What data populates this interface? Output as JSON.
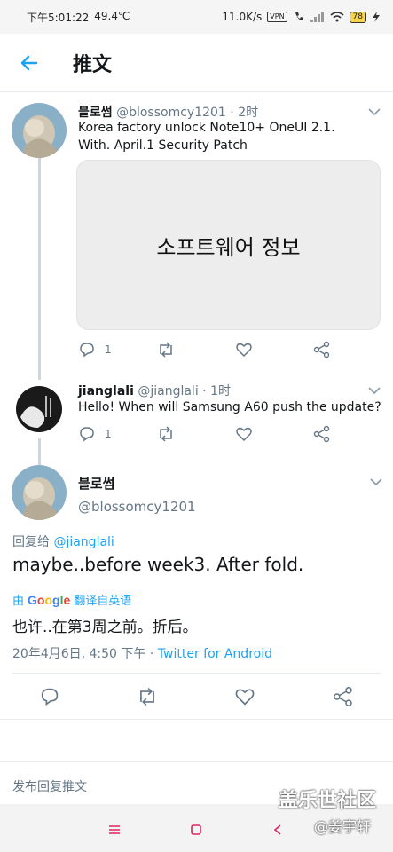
{
  "status": {
    "time": "下午5:01:22",
    "temperature": "49.4℃",
    "speed": "11.0K/s",
    "vpn": "VPN",
    "battery": "78"
  },
  "appbar": {
    "title": "推文"
  },
  "tweets": [
    {
      "name": "블로썸",
      "handle": "@blossomcy1201",
      "time": "· 2时",
      "text_line1": "Korea factory unlock Note10+ OneUI 2.1.",
      "text_line2": "With. April.1 Security Patch",
      "media_text": "소프트웨어 정보",
      "reply_count": "1"
    },
    {
      "name": "jianglali",
      "handle": "@jianglali",
      "time": "· 1时",
      "text": "Hello! When will Samsung A60 push the update?",
      "reply_count": "1"
    }
  ],
  "main_tweet": {
    "name": "블로썸",
    "handle": "@blossomcy1201",
    "reply_prefix": "回复给 ",
    "reply_mention": "@jianglali",
    "text": "maybe..before week3. After fold.",
    "translate_by": "由",
    "translate_brand": "Google",
    "translate_label": "翻译自英语",
    "translated_text": "也许..在第3周之前。折后。",
    "date": "20年4月6日, 4:50 下午 · ",
    "source": "Twitter for Android"
  },
  "composer": {
    "placeholder": "发布回复推文"
  },
  "watermark": {
    "line1": "盖乐世社区",
    "line2": "@姜宇轩"
  },
  "colors": {
    "accent": "#1da1f2",
    "muted": "#657786",
    "icon": "#657786"
  },
  "icons": [
    "back-arrow-icon",
    "chevron-down-icon",
    "reply-icon",
    "retweet-icon",
    "like-icon",
    "share-icon",
    "menu-icon",
    "home-icon",
    "back-icon"
  ]
}
